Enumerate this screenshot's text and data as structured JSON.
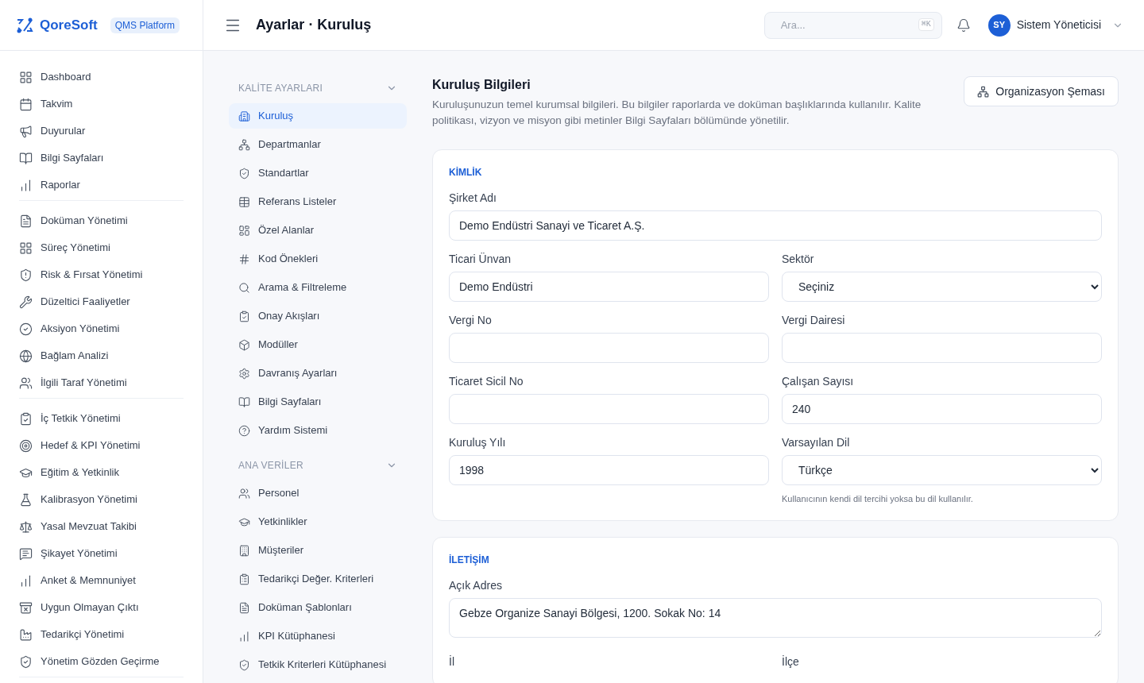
{
  "brand": {
    "name": "QoreSoft",
    "badge": "QMS Platform"
  },
  "header": {
    "title": "Ayarlar · Kuruluş",
    "search": {
      "placeholder": "Ara...",
      "shortcut": "⌘K"
    },
    "user": {
      "initials": "SY",
      "name": "Sistem Yöneticisi"
    }
  },
  "sidebar": {
    "groups": [
      {
        "items": [
          {
            "label": "Dashboard",
            "selected": false
          },
          {
            "label": "Takvim",
            "selected": false
          },
          {
            "label": "Duyurular",
            "selected": false
          },
          {
            "label": "Bilgi Sayfaları",
            "selected": false
          },
          {
            "label": "Raporlar",
            "selected": false
          }
        ]
      },
      {
        "items": [
          {
            "label": "Doküman Yönetimi",
            "selected": false
          },
          {
            "label": "Süreç Yönetimi",
            "selected": false
          },
          {
            "label": "Risk & Fırsat Yönetimi",
            "selected": false
          },
          {
            "label": "Düzeltici Faaliyetler",
            "selected": false
          },
          {
            "label": "Aksiyon Yönetimi",
            "selected": false
          },
          {
            "label": "Bağlam Analizi",
            "selected": false
          },
          {
            "label": "İlgili Taraf Yönetimi",
            "selected": false
          }
        ]
      },
      {
        "items": [
          {
            "label": "İç Tetkik Yönetimi",
            "selected": false
          },
          {
            "label": "Hedef & KPI Yönetimi",
            "selected": false
          },
          {
            "label": "Eğitim & Yetkinlik",
            "selected": false
          },
          {
            "label": "Kalibrasyon Yönetimi",
            "selected": false
          },
          {
            "label": "Yasal Mevzuat Takibi",
            "selected": false
          },
          {
            "label": "Şikayet Yönetimi",
            "selected": false
          },
          {
            "label": "Anket & Memnuniyet",
            "selected": false
          },
          {
            "label": "Uygun Olmayan Çıktı",
            "selected": false
          },
          {
            "label": "Tedarikçi Yönetimi",
            "selected": false
          },
          {
            "label": "Yönetim Gözden Geçirme",
            "selected": false
          }
        ]
      }
    ]
  },
  "settings_nav": {
    "sections": [
      {
        "title": "KALİTE AYARLARI",
        "expanded": true,
        "items": [
          {
            "label": "Kuruluş",
            "selected": true
          },
          {
            "label": "Departmanlar",
            "selected": false
          },
          {
            "label": "Standartlar",
            "selected": false
          },
          {
            "label": "Referans Listeler",
            "selected": false
          },
          {
            "label": "Özel Alanlar",
            "selected": false
          },
          {
            "label": "Kod Önekleri",
            "selected": false
          },
          {
            "label": "Arama & Filtreleme",
            "selected": false
          },
          {
            "label": "Onay Akışları",
            "selected": false
          },
          {
            "label": "Modüller",
            "selected": false
          },
          {
            "label": "Davranış Ayarları",
            "selected": false
          },
          {
            "label": "Bilgi Sayfaları",
            "selected": false
          },
          {
            "label": "Yardım Sistemi",
            "selected": false
          }
        ]
      },
      {
        "title": "ANA VERİLER",
        "expanded": true,
        "items": [
          {
            "label": "Personel",
            "selected": false
          },
          {
            "label": "Yetkinlikler",
            "selected": false
          },
          {
            "label": "Müşteriler",
            "selected": false
          },
          {
            "label": "Tedarikçi Değer. Kriterleri",
            "selected": false
          },
          {
            "label": "Doküman Şablonları",
            "selected": false
          },
          {
            "label": "KPI Kütüphanesi",
            "selected": false
          },
          {
            "label": "Tetkik Kriterleri Kütüphanesi",
            "selected": false
          }
        ]
      }
    ]
  },
  "page": {
    "title": "Kuruluş Bilgileri",
    "description": "Kuruluşunuzun temel kurumsal bilgileri. Bu bilgiler raporlarda ve doküman başlıklarında kullanılır. Kalite politikası, vizyon ve misyon gibi metinler Bilgi Sayfaları bölümünde yönetilir.",
    "action": "Organizasyon Şeması"
  },
  "cards": [
    {
      "title": "KİMLİK",
      "fields": [
        {
          "kind": "text",
          "label": "Şirket Adı",
          "value": "Demo Endüstri Sanayi ve Ticaret A.Ş.",
          "wide": true
        },
        {
          "kind": "text",
          "label": "Ticari Ünvan",
          "value": "Demo Endüstri"
        },
        {
          "kind": "select",
          "label": "Sektör",
          "value": "Seçiniz"
        },
        {
          "kind": "text",
          "label": "Vergi No"
        },
        {
          "kind": "text",
          "label": "Vergi Dairesi"
        },
        {
          "kind": "text",
          "label": "Ticaret Sicil No"
        },
        {
          "kind": "text",
          "label": "Çalışan Sayısı",
          "value": "240"
        },
        {
          "kind": "text",
          "label": "Kuruluş Yılı",
          "value": "1998"
        },
        {
          "kind": "select",
          "label": "Varsayılan Dil",
          "value": "Türkçe",
          "hint": "Kullanıcının kendi dil tercihi yoksa bu dil kullanılır."
        }
      ]
    },
    {
      "title": "İLETİŞİM",
      "fields": [
        {
          "kind": "textarea",
          "label": "Açık Adres",
          "value": "Gebze Organize Sanayi Bölgesi, 1200. Sokak No: 14",
          "wide": true
        },
        {
          "kind": "label",
          "label": "İl"
        },
        {
          "kind": "label",
          "label": "İlçe"
        }
      ]
    }
  ]
}
